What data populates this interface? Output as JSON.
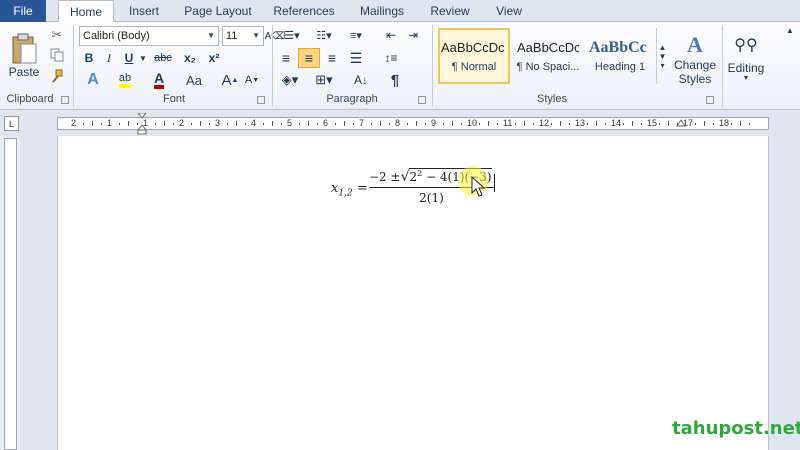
{
  "tabs": {
    "file": "File",
    "items": [
      "Home",
      "Insert",
      "Page Layout",
      "References",
      "Mailings",
      "Review",
      "View"
    ],
    "active": "Home"
  },
  "clipboard": {
    "paste_label": "Paste",
    "group_label": "Clipboard"
  },
  "font": {
    "family": "Calibri (Body)",
    "size": "11",
    "group_label": "Font",
    "bold": "B",
    "italic": "I",
    "underline": "U",
    "strike": "abc",
    "subscript": "x₂",
    "superscript": "x²",
    "grow": "A",
    "shrink": "A",
    "case": "Aa"
  },
  "paragraph": {
    "group_label": "Paragraph",
    "pilcrow": "¶"
  },
  "styles": {
    "group_label": "Styles",
    "items": [
      {
        "preview": "AaBbCcDc",
        "name": "¶ Normal",
        "selected": true
      },
      {
        "preview": "AaBbCcDc",
        "name": "¶ No Spaci...",
        "selected": false
      },
      {
        "preview": "AaBbCc",
        "name": "Heading 1",
        "selected": false
      }
    ]
  },
  "change_styles": {
    "line1": "Change",
    "line2": "Styles"
  },
  "editing": {
    "label": "Editing"
  },
  "ruler": {
    "tab_marker": "L",
    "numbers": [
      "2",
      "1",
      "1",
      "2",
      "3",
      "4",
      "5",
      "6",
      "7",
      "8",
      "9",
      "10",
      "11",
      "12",
      "13",
      "14",
      "15",
      "17",
      "18"
    ]
  },
  "equation": {
    "lhs": "x",
    "lhs_sub": "1,2",
    "eq": "=",
    "num_prefix": "−2 ±",
    "rad_base": "2",
    "rad_exp": "2",
    "rad_rest": " − 4(1)(−3)",
    "denominator": "2(1)"
  },
  "watermark": "tahupost.net",
  "colors": {
    "file_tab": "#2a5699",
    "selected_style": "#f2c45e",
    "watermark": "#2fa73c",
    "font_color": "#c00000",
    "highlight": "#ffff00"
  }
}
